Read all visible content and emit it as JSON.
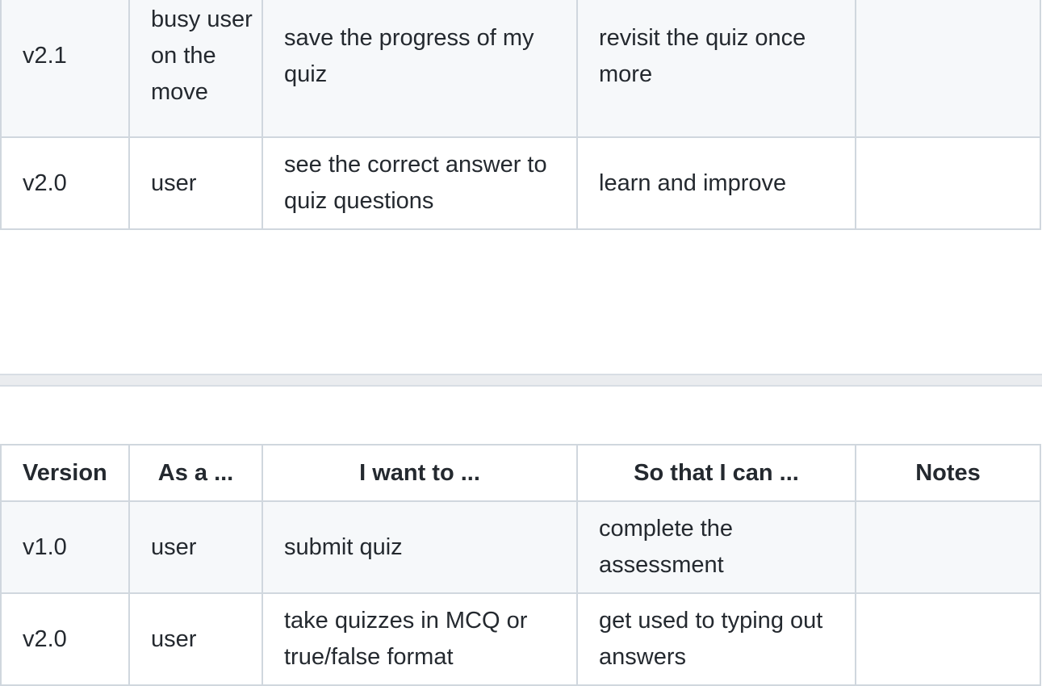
{
  "top_table": {
    "rows": [
      {
        "version": "v2.1",
        "as_a": "busy user on the move",
        "want": "save the progress of my quiz",
        "so_that": "revisit the quiz once more",
        "notes": ""
      },
      {
        "version": "v2.0",
        "as_a": "user",
        "want": "see the correct answer to quiz questions",
        "so_that": "learn and improve",
        "notes": ""
      }
    ]
  },
  "bottom_table": {
    "headers": {
      "version": "Version",
      "as_a": "As a ...",
      "want": "I want to ...",
      "so_that": "So that I can ...",
      "notes": "Notes"
    },
    "rows": [
      {
        "version": "v1.0",
        "as_a": "user",
        "want": "submit quiz",
        "so_that": "complete the assessment",
        "notes": ""
      },
      {
        "version": "v2.0",
        "as_a": "user",
        "want": "take quizzes in MCQ or true/false format",
        "so_that": "get used to typing out answers",
        "notes": ""
      }
    ]
  },
  "colors": {
    "border": "#d0d7de",
    "row_alt": "#f6f8fa",
    "text": "#24292f",
    "divider": "#eaecef"
  }
}
